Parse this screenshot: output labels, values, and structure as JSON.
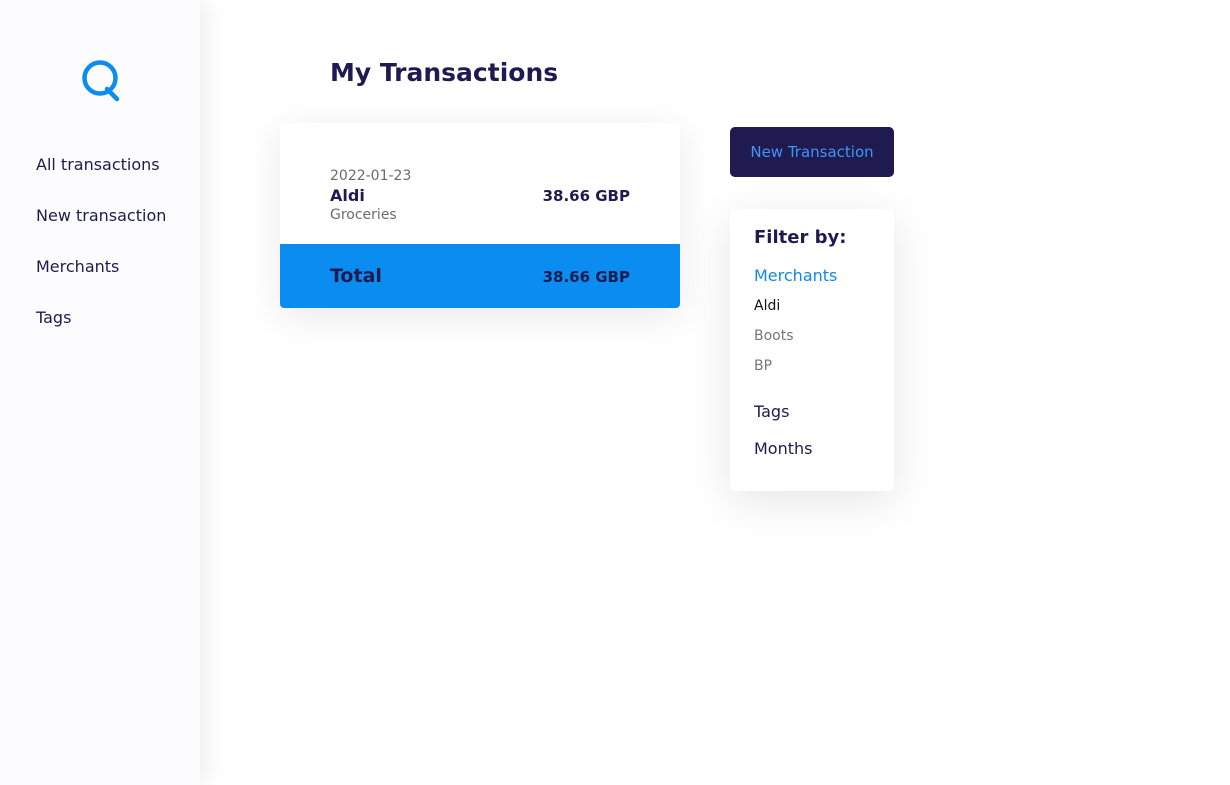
{
  "app": {
    "logo_icon": "q-logo-icon",
    "brand_color": "#0a8cf0",
    "dark_color": "#1f1a4f"
  },
  "sidebar": {
    "items": [
      {
        "label": "All transactions"
      },
      {
        "label": "New transaction"
      },
      {
        "label": "Merchants"
      },
      {
        "label": "Tags"
      }
    ]
  },
  "main": {
    "title": "My Transactions",
    "transactions": [
      {
        "date": "2022-01-23",
        "merchant": "Aldi",
        "tag": "Groceries",
        "amount": "38.66 GBP"
      }
    ],
    "total": {
      "label": "Total",
      "amount": "38.66 GBP"
    }
  },
  "actions": {
    "new_transaction_label": "New Transaction"
  },
  "filter": {
    "title": "Filter by:",
    "categories": [
      {
        "label": "Merchants",
        "active": true,
        "options": [
          {
            "label": "Aldi",
            "selected": true
          },
          {
            "label": "Boots",
            "selected": false
          },
          {
            "label": "BP",
            "selected": false
          }
        ]
      },
      {
        "label": "Tags",
        "active": false
      },
      {
        "label": "Months",
        "active": false
      }
    ]
  }
}
